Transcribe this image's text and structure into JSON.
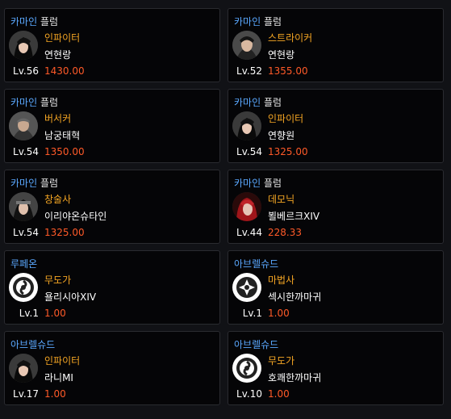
{
  "cards": [
    {
      "world": "카마인",
      "server": "플럼",
      "class": "인파이터",
      "name": "연현랑",
      "level": "Lv.56",
      "item_level": "1430.00",
      "avatar": "infighter-portrait-icon"
    },
    {
      "world": "카마인",
      "server": "플럼",
      "class": "스트라이커",
      "name": "연현랑",
      "level": "Lv.52",
      "item_level": "1355.00",
      "avatar": "striker-portrait-icon"
    },
    {
      "world": "카마인",
      "server": "플럼",
      "class": "버서커",
      "name": "남궁태혁",
      "level": "Lv.54",
      "item_level": "1350.00",
      "avatar": "berserker-portrait-icon"
    },
    {
      "world": "카마인",
      "server": "플럼",
      "class": "인파이터",
      "name": "연향원",
      "level": "Lv.54",
      "item_level": "1325.00",
      "avatar": "infighter-portrait-icon"
    },
    {
      "world": "카마인",
      "server": "플럼",
      "class": "창술사",
      "name": "이리야온슈타인",
      "level": "Lv.54",
      "item_level": "1325.00",
      "avatar": "lancemaster-portrait-icon"
    },
    {
      "world": "카마인",
      "server": "플럼",
      "class": "데모닉",
      "name": "뵐베르크XIV",
      "level": "Lv.44",
      "item_level": "228.33",
      "avatar": "demonic-portrait-icon"
    },
    {
      "world": "루페온",
      "server": "",
      "class": "무도가",
      "name": "욜리시아XIV",
      "level": "Lv.1",
      "item_level": "1.00",
      "avatar": "martial-artist-emblem-icon"
    },
    {
      "world": "아브렐슈드",
      "server": "",
      "class": "마법사",
      "name": "섹시한까마귀",
      "level": "Lv.1",
      "item_level": "1.00",
      "avatar": "mage-emblem-icon"
    },
    {
      "world": "아브렐슈드",
      "server": "",
      "class": "인파이터",
      "name": "라니MI",
      "level": "Lv.17",
      "item_level": "1.00",
      "avatar": "infighter-portrait-icon"
    },
    {
      "world": "아브렐슈드",
      "server": "",
      "class": "무도가",
      "name": "호쾌한까마귀",
      "level": "Lv.10",
      "item_level": "1.00",
      "avatar": "martial-artist-emblem-icon"
    }
  ],
  "colors": {
    "world": "#5aa8ff",
    "class": "#f5a623",
    "item_level": "#ff5a28",
    "background": "#111216",
    "card": "#050507"
  }
}
